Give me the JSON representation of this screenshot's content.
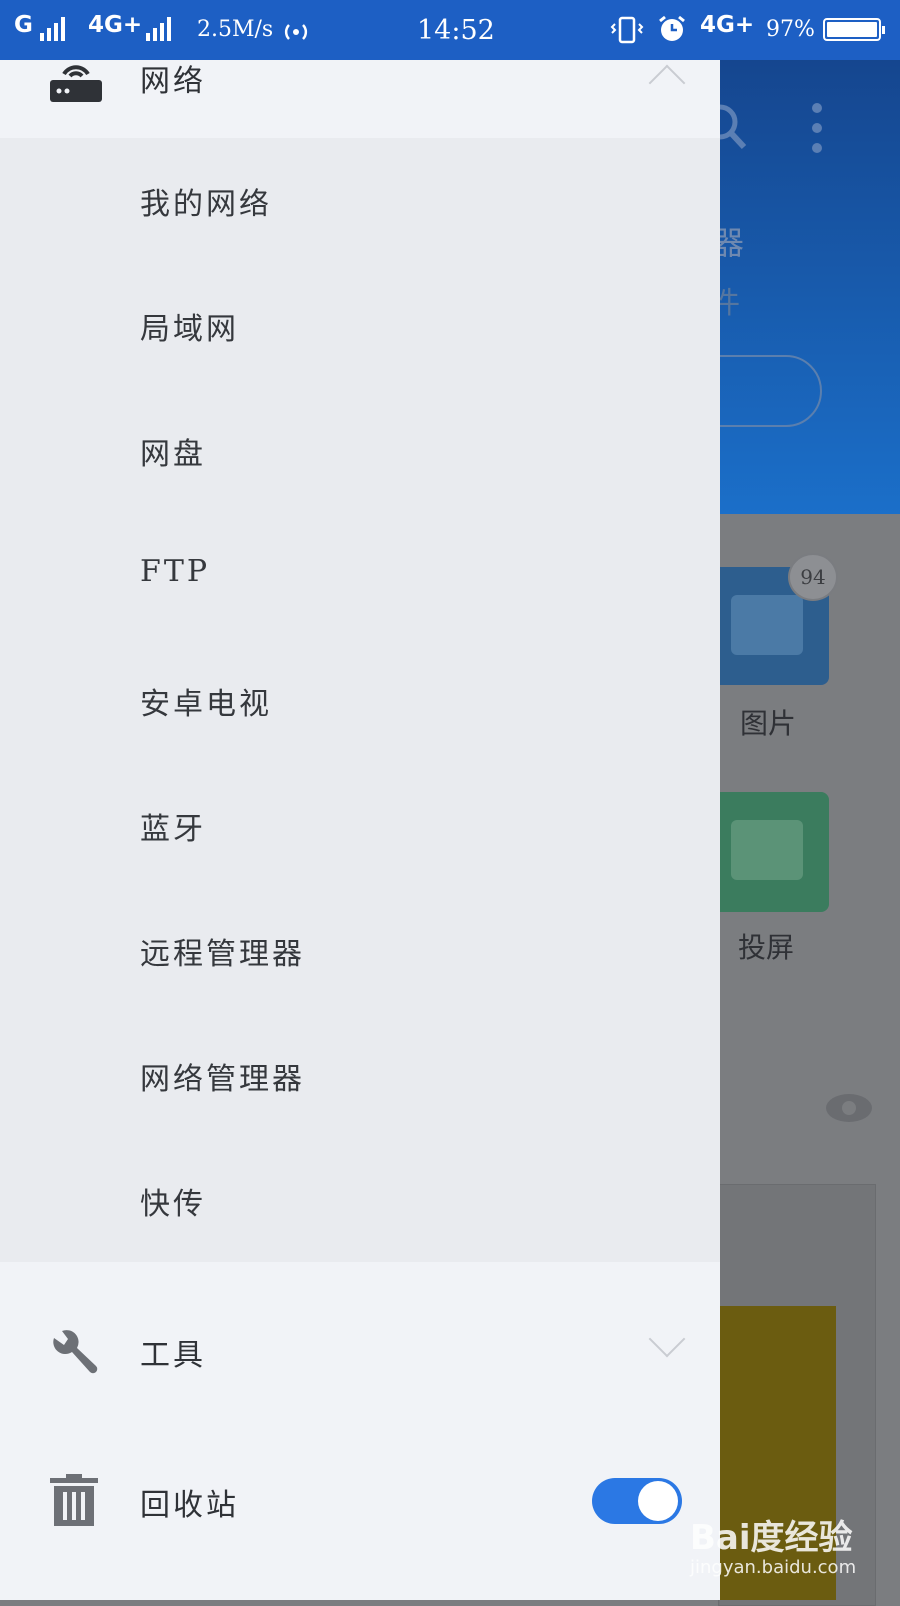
{
  "status_bar": {
    "carrier1": "G",
    "carrier2": "4G+",
    "speed": "2.5M/s",
    "time": "14:52",
    "network": "4G+",
    "battery": "97%"
  },
  "background": {
    "title_fragment": "行器",
    "subtitle_fragment": "文件",
    "tiles": [
      {
        "label": "图片",
        "badge": "94"
      },
      {
        "label": "投屏"
      }
    ],
    "colors": {
      "header": "#1b6fc9",
      "tile_images": "#2d5e8e",
      "tile_cast": "#3b7c5e"
    }
  },
  "drawer": {
    "network_section": {
      "label": "网络",
      "icon": "router-icon",
      "expanded": true
    },
    "network_items": [
      {
        "label": "我的网络"
      },
      {
        "label": "局域网"
      },
      {
        "label": "网盘"
      },
      {
        "label": "FTP"
      },
      {
        "label": "安卓电视"
      },
      {
        "label": "蓝牙"
      },
      {
        "label": "远程管理器"
      },
      {
        "label": "网络管理器"
      },
      {
        "label": "快传"
      }
    ],
    "tools_section": {
      "label": "工具",
      "icon": "wrench-icon",
      "expanded": false
    },
    "recycle_section": {
      "label": "回收站",
      "icon": "trash-icon",
      "toggle_on": true
    },
    "colors": {
      "accent": "#2b78e4",
      "drawer_bg": "#f1f3f7",
      "submenu_bg": "#e9ebef"
    }
  },
  "watermark": {
    "logo": "Bai度经验",
    "url": "jingyan.baidu.com"
  }
}
